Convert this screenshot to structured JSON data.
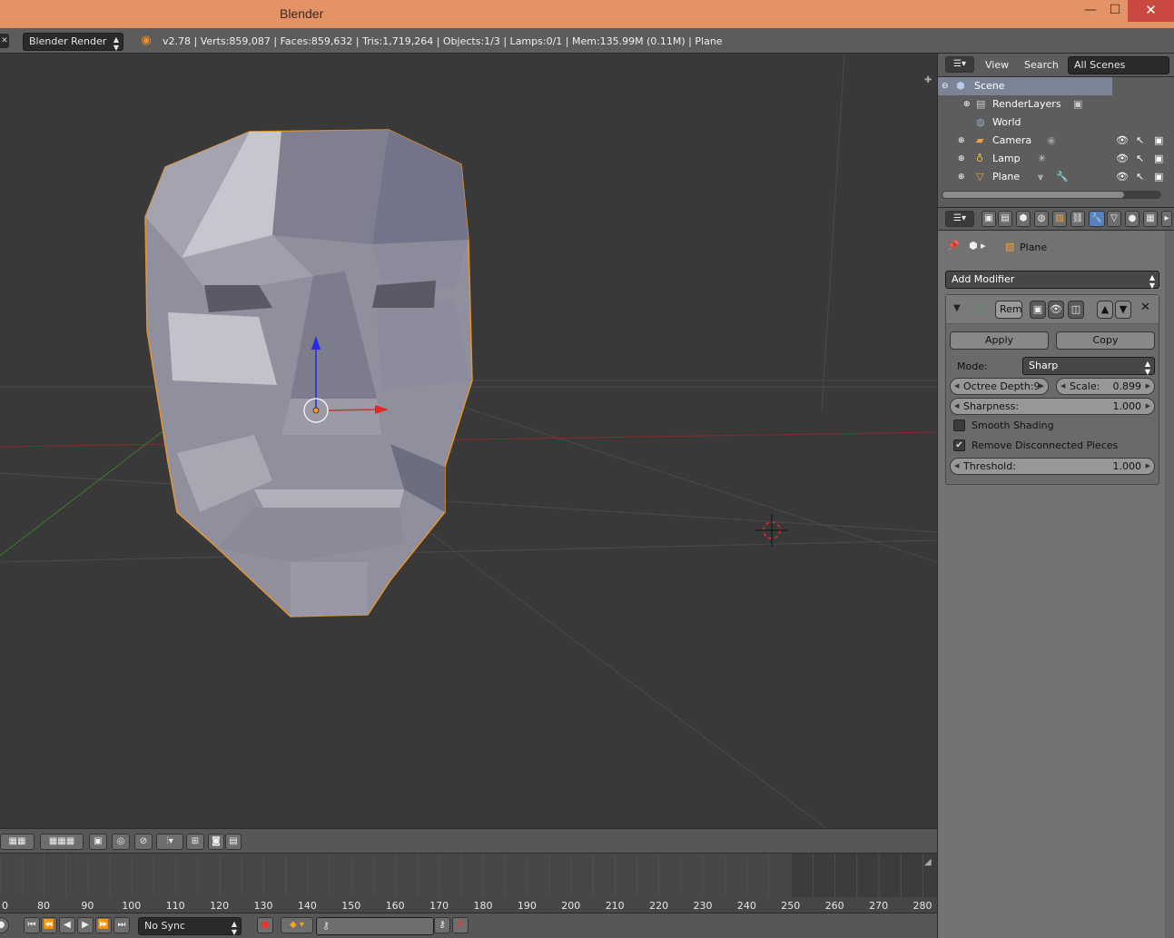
{
  "window": {
    "title": "Blender",
    "min": "—",
    "max": "☐",
    "close": "✕"
  },
  "info": {
    "render_engine": "Blender Render",
    "stats": "v2.78 | Verts:859,087 | Faces:859,632 | Tris:1,719,264 | Objects:1/3 | Lamps:0/1 | Mem:135.99M (0.11M) | Plane"
  },
  "outliner": {
    "menu_view": "View",
    "menu_search": "Search",
    "scene_filter": "All Scenes",
    "items": [
      {
        "label": "Scene"
      },
      {
        "label": "RenderLayers"
      },
      {
        "label": "World"
      },
      {
        "label": "Camera"
      },
      {
        "label": "Lamp"
      },
      {
        "label": "Plane"
      }
    ]
  },
  "properties": {
    "breadcrumb_object": "Plane",
    "add_modifier": "Add Modifier",
    "modifier_name": "Rem",
    "apply_label": "Apply",
    "copy_label": "Copy",
    "mode_label": "Mode:",
    "mode_value": "Sharp",
    "octree_label": "Octree Depth:",
    "octree_value": "9",
    "scale_label": "Scale:",
    "scale_value": "0.899",
    "sharpness_label": "Sharpness:",
    "sharpness_value": "1.000",
    "smooth_shading_label": "Smooth Shading",
    "smooth_shading_checked": false,
    "remove_disconnected_label": "Remove Disconnected Pieces",
    "remove_disconnected_checked": true,
    "threshold_label": "Threshold:",
    "threshold_value": "1.000"
  },
  "timeline": {
    "ticks": [
      "0",
      "80",
      "90",
      "100",
      "110",
      "120",
      "130",
      "140",
      "150",
      "160",
      "170",
      "180",
      "190",
      "200",
      "210",
      "220",
      "230",
      "240",
      "250",
      "260",
      "270",
      "280"
    ],
    "sync_mode": "No Sync"
  },
  "colors": {
    "selection_outline": "#e7932e",
    "x_axis": "#a02828",
    "y_axis": "#3c7a2a",
    "active_blue": "#5680c2"
  }
}
